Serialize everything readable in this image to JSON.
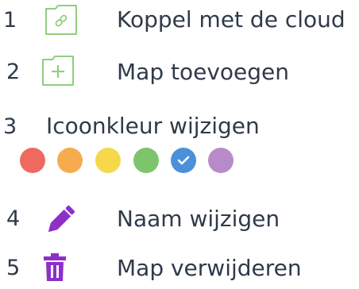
{
  "menu": {
    "items": [
      {
        "number": "1",
        "label": "Koppel met de cloud",
        "icon": "link-folder-icon"
      },
      {
        "number": "2",
        "label": "Map toevoegen",
        "icon": "add-folder-icon"
      },
      {
        "number": "3",
        "label": "Icoonkleur wijzigen"
      },
      {
        "number": "4",
        "label": "Naam wijzigen",
        "icon": "pencil-icon"
      },
      {
        "number": "5",
        "label": "Map verwijderen",
        "icon": "trash-icon"
      }
    ],
    "colors": [
      {
        "name": "red",
        "hex": "#ee6a5e",
        "selected": false
      },
      {
        "name": "orange",
        "hex": "#f6ac4e",
        "selected": false
      },
      {
        "name": "yellow",
        "hex": "#f6d94a",
        "selected": false
      },
      {
        "name": "green",
        "hex": "#7cc56c",
        "selected": false
      },
      {
        "name": "blue",
        "hex": "#4c90d9",
        "selected": true
      },
      {
        "name": "purple",
        "hex": "#b78bca",
        "selected": false
      }
    ],
    "accent": {
      "folder": "#8fcf7f",
      "pencil": "#8e2fc9",
      "trash": "#8e2fc9"
    }
  }
}
